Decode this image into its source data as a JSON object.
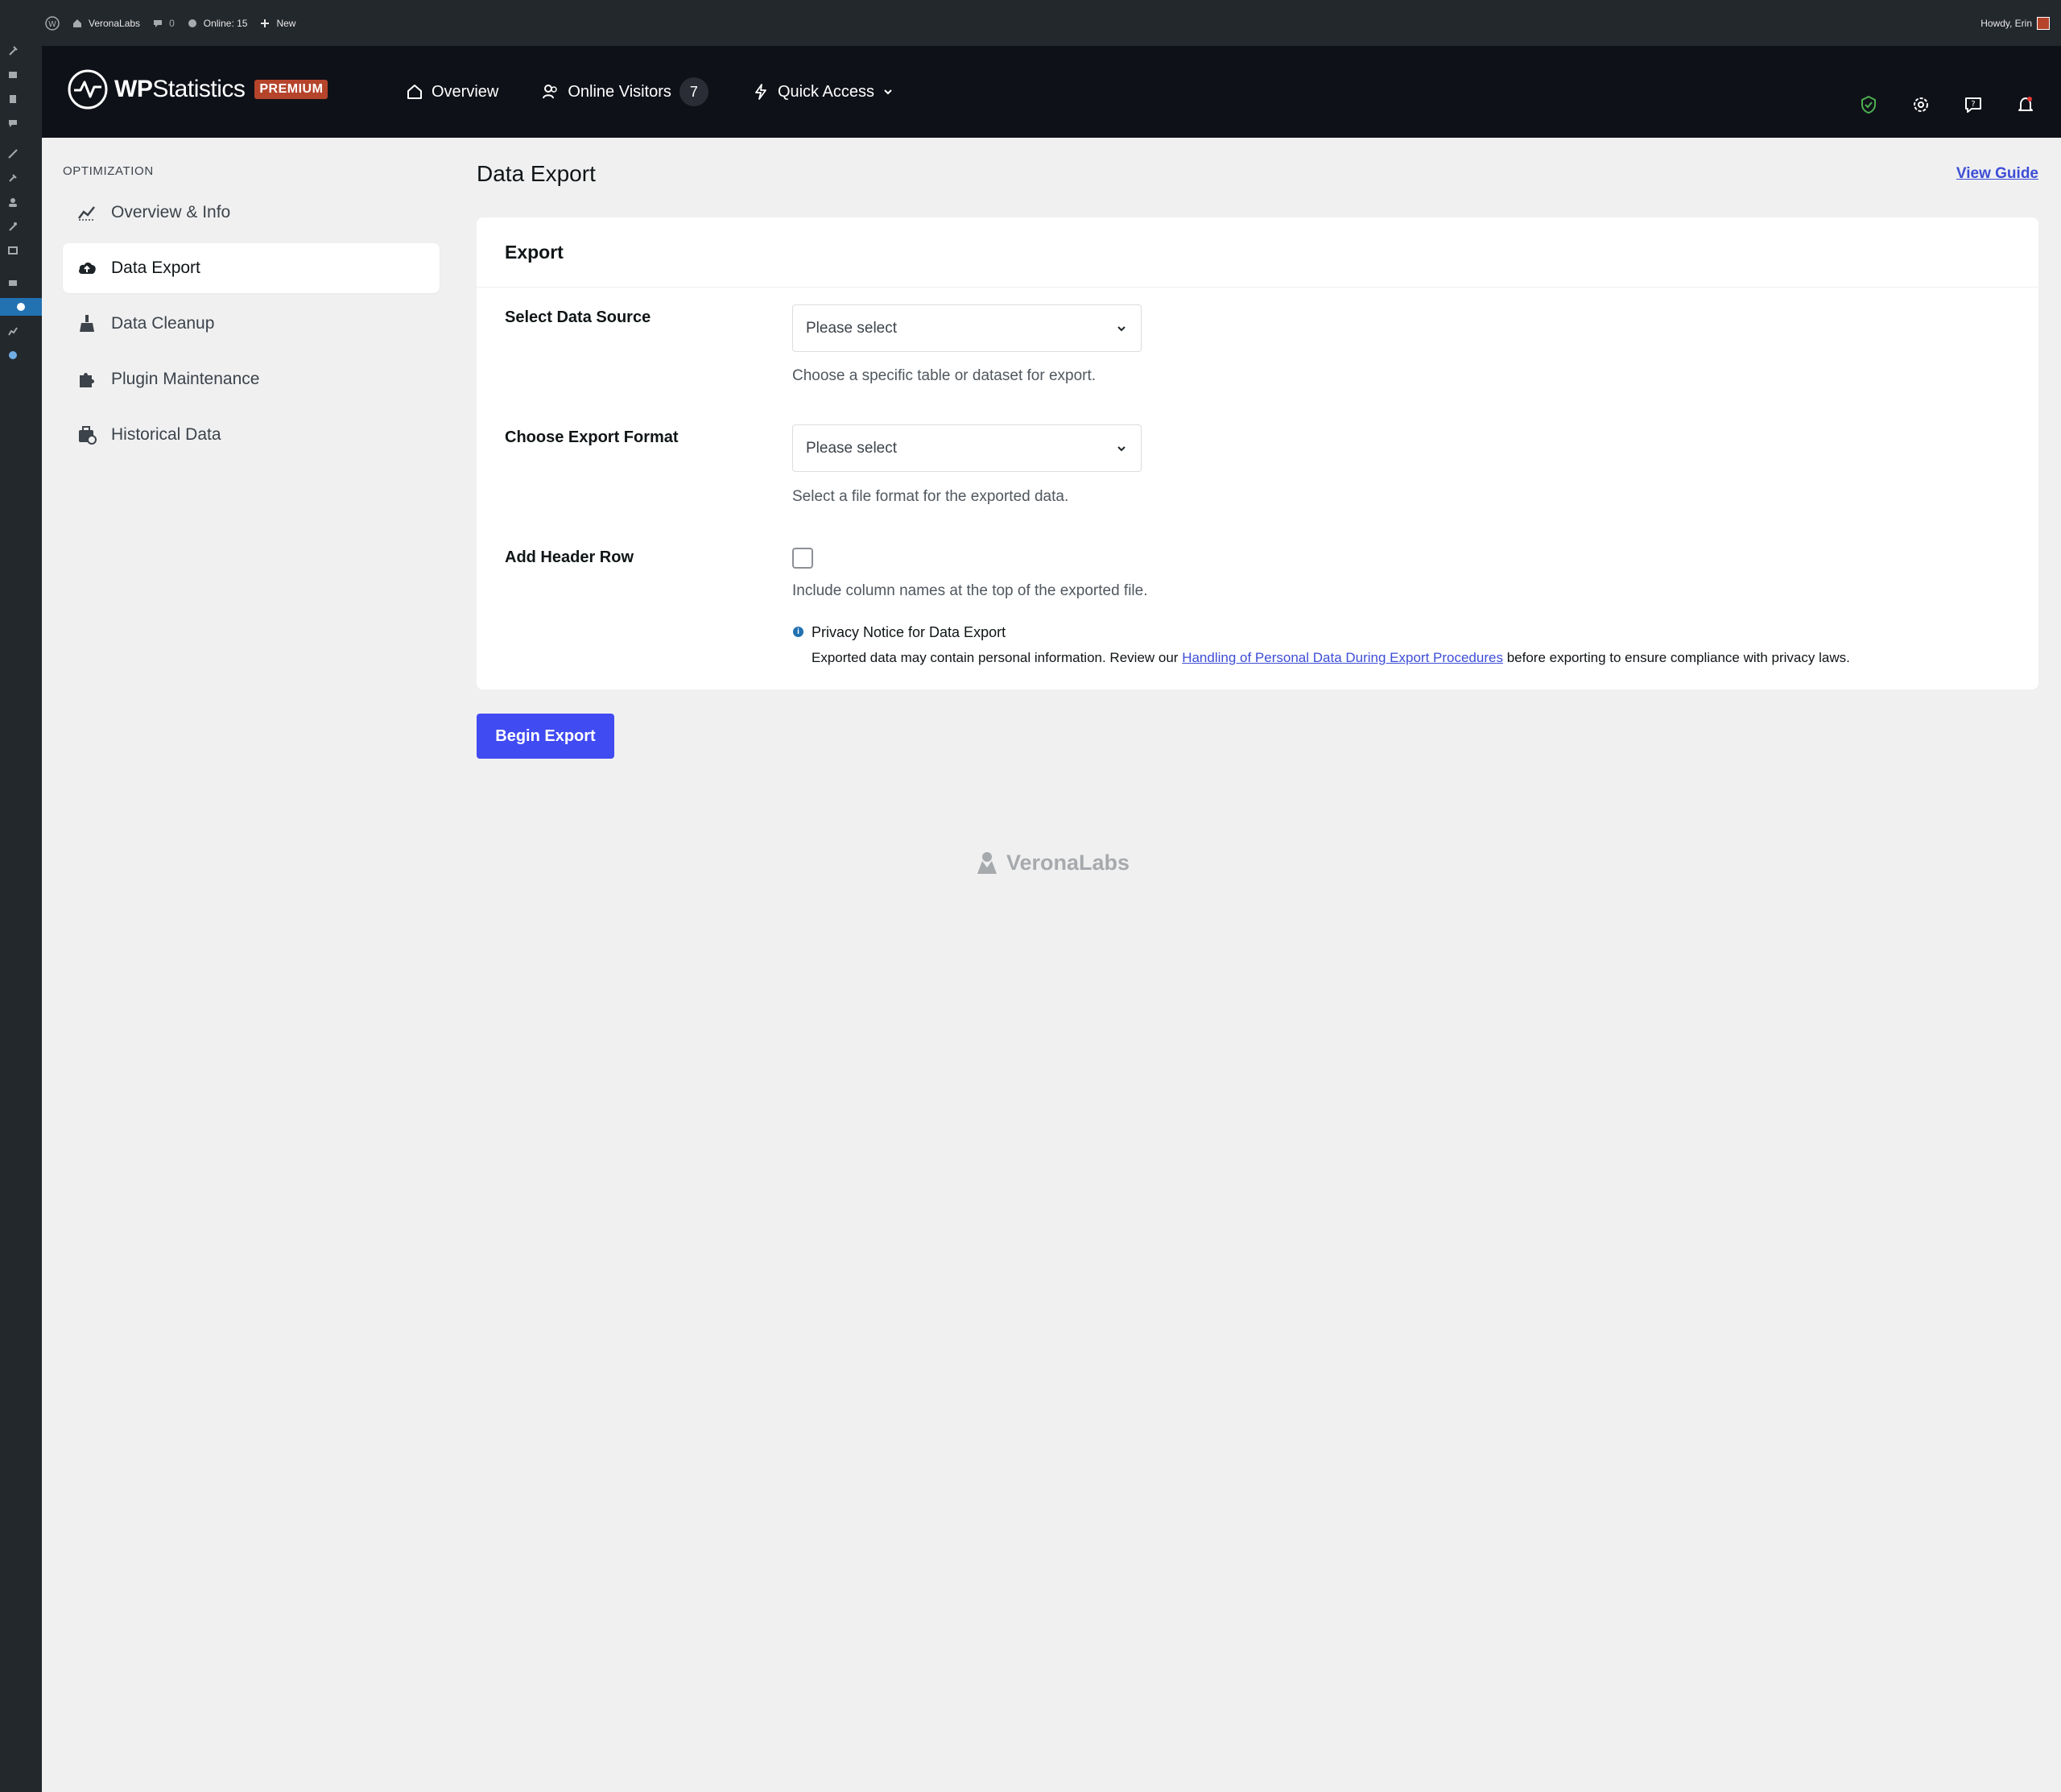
{
  "adminbar": {
    "site_name": "VeronaLabs",
    "comments_count": "0",
    "online": "Online: 15",
    "new_label": "New",
    "howdy": "Howdy, Erin"
  },
  "header": {
    "logo_text_wp": "WP",
    "logo_text_rest": "Statistics",
    "premium_badge": "PREMIUM",
    "nav": {
      "overview": "Overview",
      "online_visitors": "Online Visitors",
      "online_count": "7",
      "quick_access": "Quick Access"
    },
    "icons": [
      "shield-check-icon",
      "gear-icon",
      "help-icon",
      "bell-icon"
    ]
  },
  "sidebar": {
    "section_title": "OPTIMIZATION",
    "items": [
      {
        "label": "Overview & Info",
        "icon": "chart-line-icon"
      },
      {
        "label": "Data Export",
        "icon": "cloud-upload-icon",
        "active": true
      },
      {
        "label": "Data Cleanup",
        "icon": "broom-icon"
      },
      {
        "label": "Plugin Maintenance",
        "icon": "puzzle-icon"
      },
      {
        "label": "Historical Data",
        "icon": "briefcase-clock-icon"
      }
    ]
  },
  "main": {
    "title": "Data Export",
    "view_guide": "View Guide",
    "card_title": "Export",
    "fields": {
      "data_source_label": "Select Data Source",
      "data_source_value": "Please select",
      "data_source_help": "Choose a specific table or dataset for export.",
      "format_label": "Choose Export Format",
      "format_value": "Please select",
      "format_help": "Select a file format for the exported data.",
      "header_row_label": "Add Header Row",
      "header_row_checked": false,
      "header_row_help": "Include column names at the top of the exported file."
    },
    "notice": {
      "title": "Privacy Notice for Data Export",
      "text_before": "Exported data may contain personal information. Review our ",
      "link_text": "Handling of Personal Data During Export Procedures",
      "text_after": " before exporting to ensure compliance with privacy laws."
    },
    "begin_button": "Begin Export"
  },
  "footer": {
    "brand": "VeronaLabs"
  },
  "colors": {
    "accent": "#404bf2",
    "link": "#3d4dd6",
    "header_bg": "#0f1118",
    "adminbar_bg": "#23282d",
    "premium": "#b5442b"
  }
}
